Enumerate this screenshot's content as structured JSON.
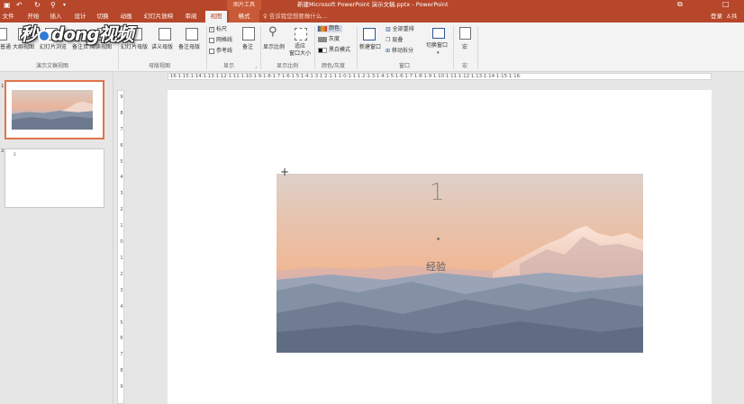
{
  "titlebar": {
    "picture_tools": "图片工具",
    "doc_title": "新建Microsoft PowerPoint 演示文稿.pptx - PowerPoint",
    "restore_glyph": "⧉",
    "close_glyph": "□"
  },
  "tabs": [
    {
      "label": "文件"
    },
    {
      "label": "开始"
    },
    {
      "label": "插入"
    },
    {
      "label": "设计"
    },
    {
      "label": "切换"
    },
    {
      "label": "动画"
    },
    {
      "label": "幻灯片放映"
    },
    {
      "label": "审阅"
    },
    {
      "label": "视图"
    },
    {
      "label": "格式"
    }
  ],
  "tell_me": "告诉我您想要做什么...",
  "account": {
    "login": "登录",
    "share": "共"
  },
  "ribbon": {
    "presentation_views": {
      "normal": "普通",
      "outline": "大纲视图",
      "sorter": "幻灯片浏览",
      "notes_page": "备注页",
      "reading": "阅读视图",
      "label": "演示文稿视图"
    },
    "master_views": {
      "slide_master": "幻灯片母版",
      "handout_master": "讲义母版",
      "notes_master": "备注母版",
      "label": "母版视图"
    },
    "show": {
      "ruler": "标尺",
      "gridlines": "网格线",
      "guides": "参考线",
      "notes": "备注",
      "label": "显示"
    },
    "zoom": {
      "zoom": "显示比例",
      "fit": "适应",
      "fit2": "窗口大小",
      "label": "显示比例"
    },
    "color": {
      "color": "颜色",
      "grayscale": "灰度",
      "bw": "黑白模式",
      "label": "颜色/灰度"
    },
    "window": {
      "new_window": "新建窗口",
      "arrange_all": "全部重排",
      "cascade": "层叠",
      "move_split": "移动拆分",
      "switch": "切换窗口",
      "label": "窗口"
    },
    "macros": {
      "macro": "宏",
      "label": "宏"
    }
  },
  "watermark": {
    "text_left": "秒",
    "text_mid": "dong",
    "text_right": "视频"
  },
  "thumbnails": [
    {
      "number": "1",
      "selected": true
    },
    {
      "number": "2",
      "selected": false,
      "small_text": "2"
    }
  ],
  "ruler": {
    "horizontal": "·16·1·15·1·14·1·13·1·12·1·11·1·10·1·9·1·8·1·7·1·6·1·5·1·4·1·3·1·2·1·1·1·0·1·1·1·2·1·3·1·4·1·5·1·6·1·7·1·8·1·9·1·10·1·11·1·12·1·13·1·14·1·15·1·16·",
    "vertical_ticks": [
      "9",
      "8",
      "7",
      "6",
      "5",
      "4",
      "3",
      "2",
      "1",
      "0",
      "1",
      "2",
      "3",
      "4",
      "5",
      "6",
      "7",
      "8",
      "9"
    ]
  },
  "slide": {
    "number": "1",
    "text": "经验"
  },
  "colors": {
    "brand": "#b7472a",
    "selection": "#e1734b"
  }
}
